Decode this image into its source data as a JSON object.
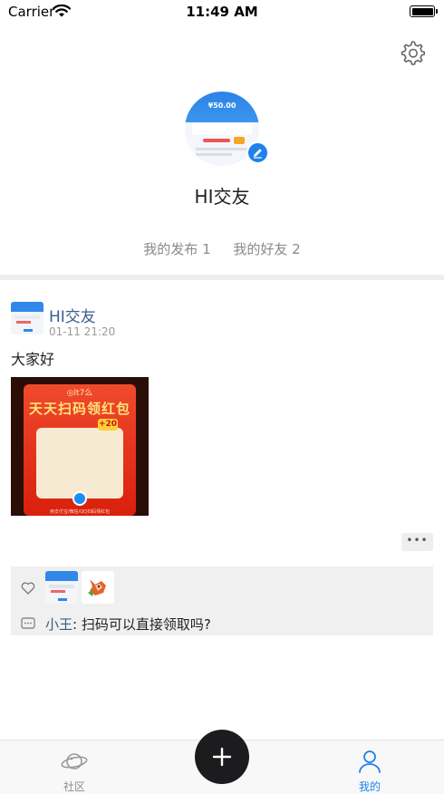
{
  "status_bar": {
    "carrier": "Carrier",
    "time": "11:49 AM",
    "icons": [
      "wifi-icon",
      "battery-icon"
    ]
  },
  "profile": {
    "avatar_amount": "¥50.00",
    "nickname": "HI交友",
    "posts_label": "我的发布 1",
    "friends_label": "我的好友 2",
    "settings_icon": "gear-icon",
    "edit_icon": "pencil-icon"
  },
  "post": {
    "author": "HI交友",
    "time": "01-11 21:20",
    "text": "大家好",
    "image": {
      "logo_text": "◎lt7么",
      "title": "天天扫码领红包",
      "badge": "+20",
      "footer": "用支付宝/微信/QQ扫码领红包"
    },
    "more_label": "•••",
    "like_icon": "heart-icon",
    "comment_icon": "comment-icon",
    "comments": [
      {
        "name": "小王",
        "separator": ": ",
        "text": "扫码可以直接领取吗?"
      }
    ]
  },
  "tabbar": {
    "community_label": "社区",
    "mine_label": "我的",
    "add_icon": "plus-icon",
    "active_color": "#1e82ea",
    "inactive_color": "#8c8c8c"
  }
}
